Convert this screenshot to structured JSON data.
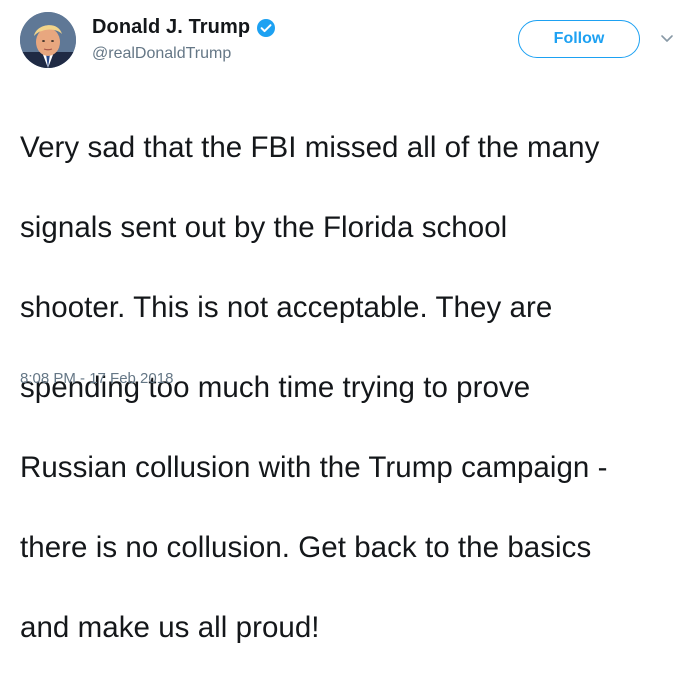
{
  "author": {
    "display_name": "Donald J. Trump",
    "handle": "@realDonaldTrump",
    "verified": true,
    "avatar_icon": "profile-photo"
  },
  "actions": {
    "follow_label": "Follow",
    "menu_icon": "chevron-down-icon"
  },
  "tweet": {
    "lines": [
      "Very sad that the FBI missed all of the many",
      "signals sent out by the Florida school",
      "shooter. This is not acceptable. They are",
      "spending too much time trying to prove",
      "Russian collusion with the Trump campaign -",
      "there is no collusion. Get back to the basics",
      "and make us all proud!"
    ],
    "timestamp": "8:08 PM - 17 Feb 2018"
  },
  "colors": {
    "accent": "#1da1f2",
    "text": "#14171a",
    "secondary_text": "#657786"
  }
}
